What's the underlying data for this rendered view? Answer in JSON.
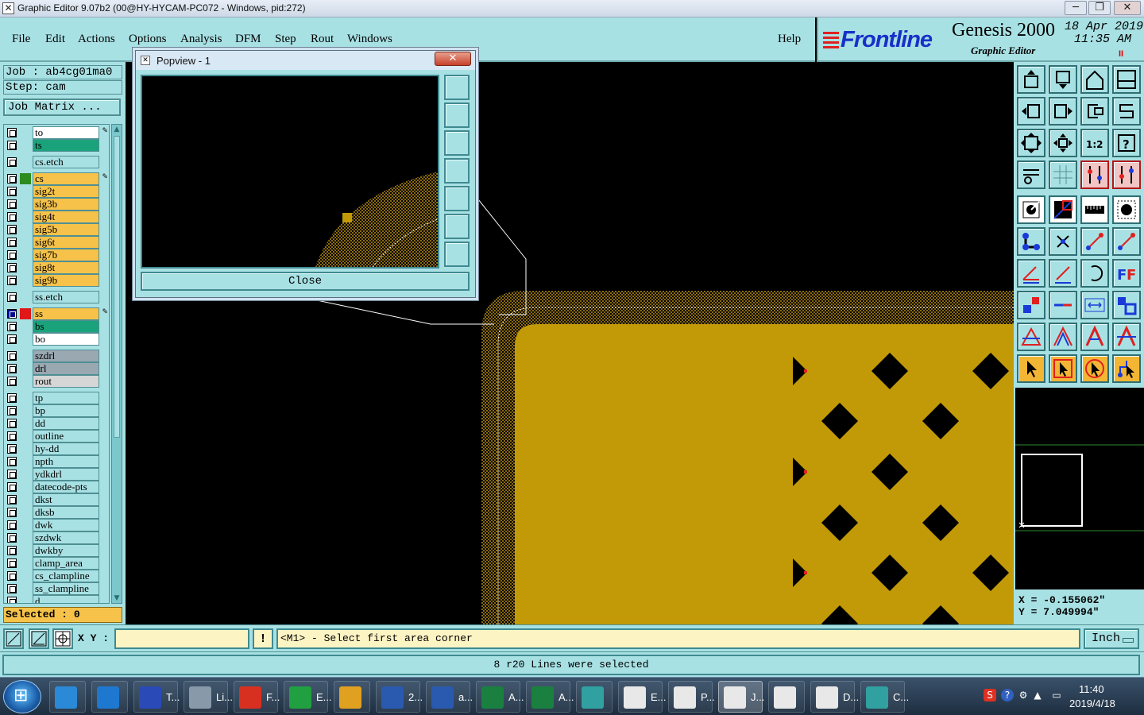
{
  "window": {
    "title": "Graphic Editor 9.07b2 (00@HY-HYCAM-PC072 - Windows, pid:272)",
    "minimize": "─",
    "restore": "❐",
    "close": "✕"
  },
  "menu": {
    "items": [
      "File",
      "Edit",
      "Actions",
      "Options",
      "Analysis",
      "DFM",
      "Step",
      "Rout",
      "Windows"
    ],
    "help": "Help"
  },
  "brand": {
    "logo": "Frontline",
    "product": "Genesis 2000",
    "subtitle": "Graphic Editor",
    "date": "18 Apr 2019",
    "time": "11:35 AM",
    "pause_indicator": "II"
  },
  "job": {
    "job_line": "Job : ab4cg01ma0",
    "step_line": "Step: cam",
    "matrix_button": "Job Matrix ..."
  },
  "layers": [
    {
      "name": "to",
      "color": "#ffffff",
      "swatch": "",
      "pen": true
    },
    {
      "name": "ts",
      "color": "#1aa37a",
      "swatch": ""
    },
    {
      "name": "cs.etch",
      "color": "#a8e1e4",
      "swatch": "",
      "gap": true
    },
    {
      "name": "cs",
      "color": "#f6c24a",
      "swatch": "#2e8b20",
      "pen": true,
      "gap": true
    },
    {
      "name": "sig2t",
      "color": "#f6c24a",
      "swatch": ""
    },
    {
      "name": "sig3b",
      "color": "#f6c24a",
      "swatch": ""
    },
    {
      "name": "sig4t",
      "color": "#f6c24a",
      "swatch": ""
    },
    {
      "name": "sig5b",
      "color": "#f6c24a",
      "swatch": ""
    },
    {
      "name": "sig6t",
      "color": "#f6c24a",
      "swatch": ""
    },
    {
      "name": "sig7b",
      "color": "#f6c24a",
      "swatch": ""
    },
    {
      "name": "sig8t",
      "color": "#f6c24a",
      "swatch": ""
    },
    {
      "name": "sig9b",
      "color": "#f6c24a",
      "swatch": ""
    },
    {
      "name": "ss.etch",
      "color": "#a8e1e4",
      "swatch": "",
      "gap": true
    },
    {
      "name": "ss",
      "color": "#f6c24a",
      "swatch": "#e01818",
      "pen": true,
      "dark": true,
      "gap": true
    },
    {
      "name": "bs",
      "color": "#1aa37a",
      "swatch": ""
    },
    {
      "name": "bo",
      "color": "#ffffff",
      "swatch": ""
    },
    {
      "name": "szdrl",
      "color": "#9aa8b2",
      "swatch": "",
      "gap": true
    },
    {
      "name": "drl",
      "color": "#9aa8b2",
      "swatch": ""
    },
    {
      "name": "rout",
      "color": "#d6d6d6",
      "swatch": ""
    },
    {
      "name": "tp",
      "color": "#a8e1e4",
      "swatch": "",
      "gap": true
    },
    {
      "name": "bp",
      "color": "#a8e1e4",
      "swatch": ""
    },
    {
      "name": "dd",
      "color": "#a8e1e4",
      "swatch": ""
    },
    {
      "name": "outline",
      "color": "#a8e1e4",
      "swatch": ""
    },
    {
      "name": "hy-dd",
      "color": "#a8e1e4",
      "swatch": ""
    },
    {
      "name": "npth",
      "color": "#a8e1e4",
      "swatch": ""
    },
    {
      "name": "ydkdrl",
      "color": "#a8e1e4",
      "swatch": ""
    },
    {
      "name": "datecode-pts",
      "color": "#a8e1e4",
      "swatch": ""
    },
    {
      "name": "dkst",
      "color": "#a8e1e4",
      "swatch": ""
    },
    {
      "name": "dksb",
      "color": "#a8e1e4",
      "swatch": ""
    },
    {
      "name": "dwk",
      "color": "#a8e1e4",
      "swatch": ""
    },
    {
      "name": "szdwk",
      "color": "#a8e1e4",
      "swatch": ""
    },
    {
      "name": "dwkby",
      "color": "#a8e1e4",
      "swatch": ""
    },
    {
      "name": "clamp_area",
      "color": "#a8e1e4",
      "swatch": ""
    },
    {
      "name": "cs_clampline",
      "color": "#a8e1e4",
      "swatch": ""
    },
    {
      "name": "ss_clampline",
      "color": "#a8e1e4",
      "swatch": ""
    },
    {
      "name": "d",
      "color": "#a8e1e4",
      "swatch": ""
    }
  ],
  "selected_count": "Selected : 0",
  "popview": {
    "title": "Popview - 1",
    "close_button": "Close"
  },
  "coords": {
    "x": "X = -0.155062\"",
    "y": "Y = 7.049994\""
  },
  "command": {
    "xy_label": "X Y :",
    "xy_value": "",
    "bang": "!",
    "prompt": "<M1> - Select first area corner",
    "unit": "Inch"
  },
  "status_message": "8 r20 Lines were selected",
  "taskbar": {
    "items": [
      {
        "label": "",
        "icon": "bird-app-icon",
        "color": "#2a8ad8"
      },
      {
        "label": "",
        "icon": "internet-explorer-icon",
        "color": "#1e78d0"
      },
      {
        "label": "T...",
        "icon": "save-disk-icon",
        "color": "#2a4ab8"
      },
      {
        "label": "Li...",
        "icon": "notepad-icon",
        "color": "#8899aa"
      },
      {
        "label": "F...",
        "icon": "f-red-app-icon",
        "color": "#d83020"
      },
      {
        "label": "E...",
        "icon": "f-green-app-icon",
        "color": "#20a040"
      },
      {
        "label": "",
        "icon": "shell-icon",
        "color": "#e0a020"
      },
      {
        "label": "2...",
        "icon": "word-doc-icon",
        "color": "#2a5ab0"
      },
      {
        "label": "a...",
        "icon": "word-doc-icon",
        "color": "#2a5ab0"
      },
      {
        "label": "A...",
        "icon": "excel-icon",
        "color": "#1a8040"
      },
      {
        "label": "A...",
        "icon": "excel-icon",
        "color": "#1a8040"
      },
      {
        "label": "",
        "icon": "eye-app-icon",
        "color": "#30a0a0"
      },
      {
        "label": "E...",
        "icon": "genesis-x-icon",
        "color": "#e8e8e8"
      },
      {
        "label": "P...",
        "icon": "genesis-x-icon",
        "color": "#e8e8e8"
      },
      {
        "label": "J...",
        "icon": "genesis-x-icon",
        "color": "#e8e8e8",
        "active": true
      },
      {
        "label": "",
        "icon": "genesis-x-icon",
        "color": "#e8e8e8"
      },
      {
        "label": "D...",
        "icon": "genesis-x-icon",
        "color": "#e8e8e8"
      },
      {
        "label": "C...",
        "icon": "eye-app-icon",
        "color": "#30a0a0"
      }
    ],
    "clock_time": "11:40",
    "clock_date": "2019/4/18"
  }
}
